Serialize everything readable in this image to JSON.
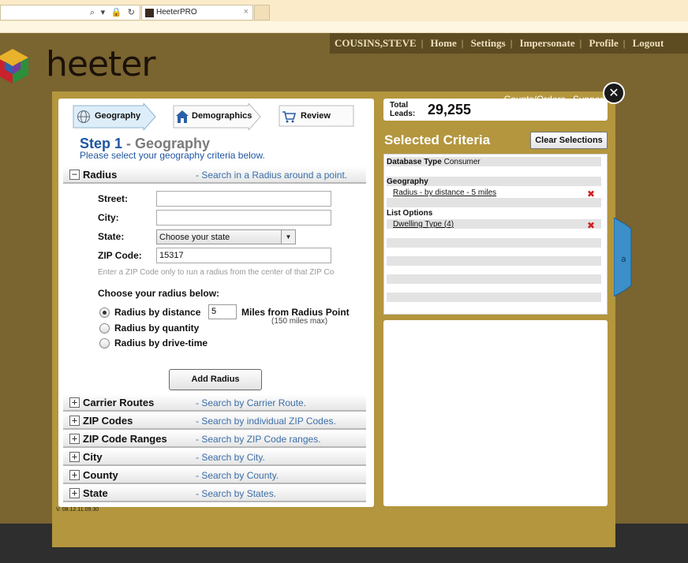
{
  "browser": {
    "address_icons": "⌕ ▾ 🔒 ↻",
    "tab_title": "HeeterPRO",
    "tab_close": "×"
  },
  "nav": {
    "user": "COUSINS,STEVE",
    "links": [
      "Home",
      "Settings",
      "Impersonate",
      "Profile",
      "Logout"
    ]
  },
  "brand": {
    "logo_text": "heeter"
  },
  "toplinks": {
    "counts": "Counts/Orders",
    "support": "Support"
  },
  "close_label": "✕",
  "steps": [
    {
      "label": "Geography",
      "icon": "globe-icon"
    },
    {
      "label": "Demographics",
      "icon": "house-icon"
    },
    {
      "label": "Review",
      "icon": "cart-icon"
    }
  ],
  "step_heading": {
    "number": "Step 1",
    "dash": " - ",
    "name": "Geography",
    "subtitle": "Please select your geography criteria below."
  },
  "radius_section": {
    "name": "Radius",
    "desc": "- Search in a Radius around a point.",
    "toggle": "−"
  },
  "form": {
    "street_label": "Street:",
    "street_value": "",
    "city_label": "City:",
    "city_value": "",
    "state_label": "State:",
    "state_value": "Choose your state",
    "zip_label": "ZIP Code:",
    "zip_value": "15317",
    "hint": "Enter a ZIP Code only to run a radius from the center of that ZIP Code.",
    "choose_label": "Choose your radius below:",
    "radius_options": [
      "Radius by distance",
      "Radius by quantity",
      "Radius by drive-time"
    ],
    "selected_option": "Radius by distance",
    "distance_value": "5",
    "miles_label": "Miles from Radius Point",
    "max_note": "(150 miles max)",
    "add_button": "Add Radius"
  },
  "sections": [
    {
      "name": "Carrier Routes",
      "desc": "- Search by Carrier Route."
    },
    {
      "name": "ZIP Codes",
      "desc": "- Search by individual ZIP Codes."
    },
    {
      "name": "ZIP Code Ranges",
      "desc": "- Search by ZIP Code ranges."
    },
    {
      "name": "City",
      "desc": "- Search by City."
    },
    {
      "name": "County",
      "desc": "- Search by County."
    },
    {
      "name": "State",
      "desc": "- Search by States."
    }
  ],
  "section_toggle": "+",
  "leads": {
    "label_line1": "Total",
    "label_line2": "Leads:",
    "count": "29,255"
  },
  "selected": {
    "title": "Selected Criteria",
    "clear_button": "Clear Selections",
    "database_label": "Database Type",
    "database_value": "Consumer",
    "geography_header": "Geography",
    "geography_item": "Radius - by distance - 5 miles",
    "list_header": "List Options",
    "list_item": "Dwelling Type (4)",
    "remove_glyph": "✖"
  },
  "version": "V. 08.12.11.09.30"
}
